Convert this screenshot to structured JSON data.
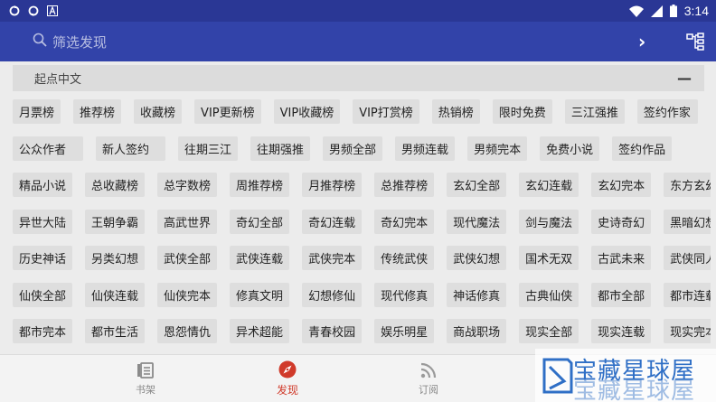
{
  "status_bar": {
    "time": "3:14",
    "icons": [
      "sync-icon",
      "sync-icon",
      "font-icon",
      "wifi-icon",
      "signal-icon",
      "battery-icon"
    ]
  },
  "toolbar": {
    "search_placeholder": "筛选发现",
    "icons": [
      "search-icon",
      "chevron-right-icon",
      "sitemap-icon"
    ]
  },
  "group": {
    "title": "起点中文",
    "collapse_symbol": "—"
  },
  "tag_rows": [
    [
      "月票榜",
      "推荐榜",
      "收藏榜",
      "VIP更新榜",
      "VIP收藏榜",
      "VIP打赏榜",
      "热销榜",
      "限时免费",
      "三江强推",
      "签约作家"
    ],
    [
      "公众作者",
      "新人签约",
      "往期三江",
      "往期强推",
      "男频全部",
      "男频连载",
      "男频完本",
      "免费小说",
      "签约作品"
    ],
    [
      "精品小说",
      "总收藏榜",
      "总字数榜",
      "周推荐榜",
      "月推荐榜",
      "总推荐榜",
      "玄幻全部",
      "玄幻连载",
      "玄幻完本",
      "东方玄幻"
    ],
    [
      "异世大陆",
      "王朝争霸",
      "高武世界",
      "奇幻全部",
      "奇幻连载",
      "奇幻完本",
      "现代魔法",
      "剑与魔法",
      "史诗奇幻",
      "黑暗幻想"
    ],
    [
      "历史神话",
      "另类幻想",
      "武侠全部",
      "武侠连载",
      "武侠完本",
      "传统武侠",
      "武侠幻想",
      "国术无双",
      "古武未来",
      "武侠同人"
    ],
    [
      "仙侠全部",
      "仙侠连载",
      "仙侠完本",
      "修真文明",
      "幻想修仙",
      "现代修真",
      "神话修真",
      "古典仙侠",
      "都市全部",
      "都市连载"
    ],
    [
      "都市完本",
      "都市生活",
      "恩怨情仇",
      "异术超能",
      "青春校园",
      "娱乐明星",
      "商战职场",
      "现实全部",
      "现实连载",
      "现实完本"
    ]
  ],
  "tabs": [
    {
      "label": "书架",
      "icon": "bookshelf-icon",
      "active": false
    },
    {
      "label": "发现",
      "icon": "compass-icon",
      "active": true
    },
    {
      "label": "订阅",
      "icon": "rss-icon",
      "active": false
    }
  ],
  "watermark": {
    "text": "宝藏星球屋",
    "icon": "watermark-logo"
  },
  "colors": {
    "status_bar": "#2a3795",
    "toolbar": "#3243a9",
    "active_tab": "#d03a2a",
    "tag_bg": "#dedede",
    "header_bg": "#dcdcdc"
  }
}
